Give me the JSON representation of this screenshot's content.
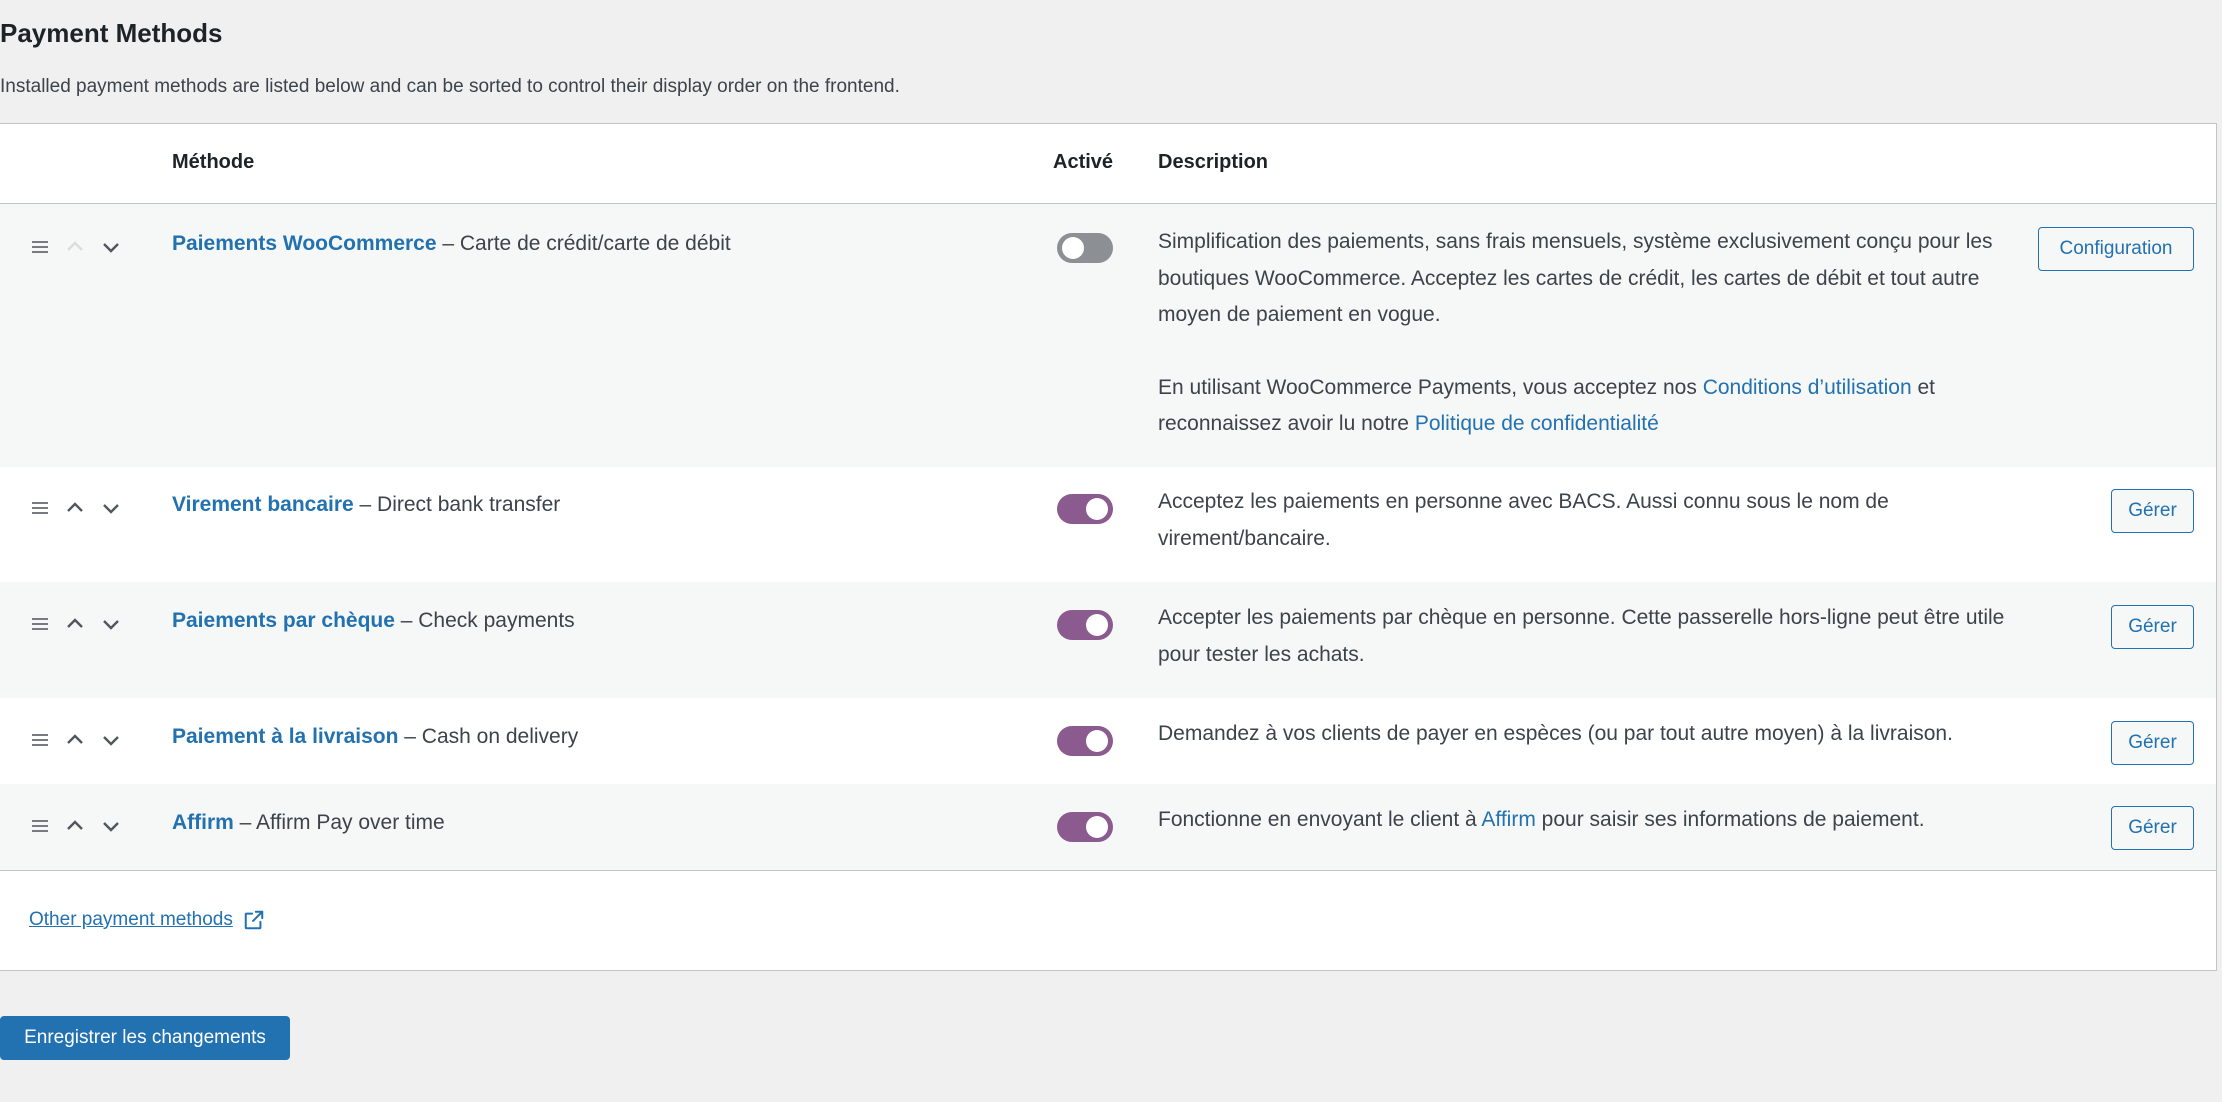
{
  "page": {
    "title": "Payment Methods",
    "description": "Installed payment methods are listed below and can be sorted to control their display order on the frontend."
  },
  "table": {
    "headers": {
      "method": "Méthode",
      "enabled": "Activé",
      "description": "Description"
    },
    "rows": [
      {
        "name": "Paiements WooCommerce",
        "subtitle": " – Carte de crédit/carte de débit",
        "enabled": false,
        "desc1": "Simplification des paiements, sans frais mensuels, système exclusivement conçu pour les boutiques WooCommerce. Acceptez les cartes de crédit, les cartes de débit et tout autre moyen de paiement en vogue.",
        "desc2_a": "En utilisant WooCommerce Payments, vous acceptez nos ",
        "desc2_link1": "Conditions d’utilisation",
        "desc2_b": " et reconnaissez avoir lu notre ",
        "desc2_link2": "Politique de confidentialité",
        "action": "Configuration"
      },
      {
        "name": "Virement bancaire",
        "subtitle": " – Direct bank transfer",
        "enabled": true,
        "desc": "Acceptez les paiements en personne avec BACS. Aussi connu sous le nom de virement/bancaire.",
        "action": "Gérer"
      },
      {
        "name": "Paiements par chèque",
        "subtitle": " – Check payments",
        "enabled": true,
        "desc": "Accepter les paiements par chèque en personne. Cette passerelle hors-ligne peut être utile pour tester les achats.",
        "action": "Gérer"
      },
      {
        "name": "Paiement à la livraison",
        "subtitle": " – Cash on delivery",
        "enabled": true,
        "desc": "Demandez à vos clients de payer en espèces (ou par tout autre moyen) à la livraison.",
        "action": "Gérer"
      },
      {
        "name": "Affirm",
        "subtitle": " – Affirm Pay over time",
        "enabled": true,
        "desc_a": "Fonctionne en envoyant le client à ",
        "desc_link": "Affirm",
        "desc_b": " pour saisir ses informations de paiement.",
        "action": "Gérer"
      }
    ]
  },
  "footer": {
    "other_methods": "Other payment methods"
  },
  "save_label": "Enregistrer les changements",
  "colors": {
    "accent": "#2271b1",
    "toggle_on": "#8b5a8f",
    "toggle_off": "#8c8f94"
  },
  "icons": {
    "drag": "drag-handle-icon",
    "up": "chevron-up-icon",
    "down": "chevron-down-icon",
    "external": "external-link-icon"
  }
}
